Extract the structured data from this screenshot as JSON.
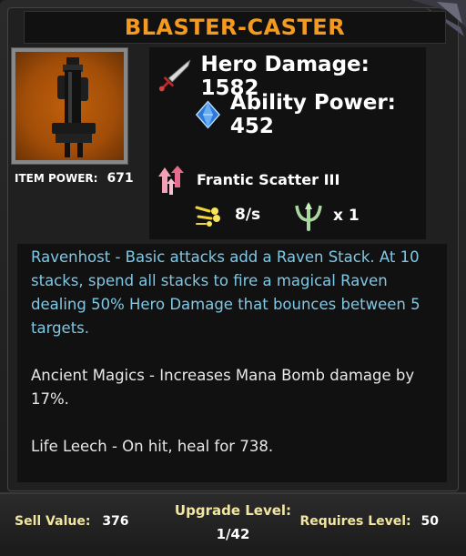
{
  "item": {
    "name": "BLASTER-CASTER",
    "power_label": "ITEM POWER:",
    "power_value": "671"
  },
  "stats": {
    "hero_damage": "Hero Damage: 1582",
    "ability_power": "Ability Power: 452",
    "perk_name": "Frantic Scatter III",
    "attack_speed": "8/s",
    "projectiles": "x 1"
  },
  "description": {
    "ravenhost": "Ravenhost - Basic attacks add a Raven Stack. At 10 stacks, spend all stacks to fire a magical Raven dealing 50% Hero Damage that bounces between 5 targets.",
    "ancient_magics": "Ancient Magics - Increases Mana Bomb damage by 17%.",
    "life_leech": "Life Leech - On hit, heal for 738."
  },
  "footer": {
    "sell_label": "Sell Value:",
    "sell_value": "376",
    "upgrade_label": "Upgrade Level:",
    "upgrade_value": "1/42",
    "requires_label": "Requires Level:",
    "requires_value": "50"
  },
  "colors": {
    "title": "#f59a1f",
    "description_blue": "#7fc8e6",
    "footer_label": "#f2e6a0",
    "icon_background": "#c0600c"
  },
  "icons": [
    "sword-icon",
    "diamond-icon",
    "arrows-up-icon",
    "scatter-shot-icon",
    "trident-icon",
    "weapon-icon"
  ]
}
